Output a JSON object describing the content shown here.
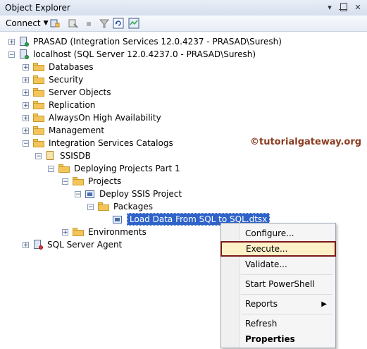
{
  "window": {
    "title": "Object Explorer",
    "controls": [
      "dropdown-icon",
      "pin-icon",
      "close-icon"
    ]
  },
  "toolbar": {
    "connect_label": "Connect",
    "icons": [
      "connect-object-icon",
      "disconnect-icon",
      "stop-icon",
      "filter-icon",
      "refresh-icon",
      "activity-monitor-icon"
    ]
  },
  "tree": {
    "items": [
      {
        "label": "PRASAD (Integration Services 12.0.4237 - PRASAD\\Suresh)",
        "icon": "server-icon",
        "expander": "+"
      },
      {
        "label": "localhost (SQL Server 12.0.4237.0 - PRASAD\\Suresh)",
        "icon": "server-icon",
        "expander": "−"
      },
      {
        "label": "Databases",
        "icon": "folder-icon",
        "expander": "+"
      },
      {
        "label": "Security",
        "icon": "folder-icon",
        "expander": "+"
      },
      {
        "label": "Server Objects",
        "icon": "folder-icon",
        "expander": "+"
      },
      {
        "label": "Replication",
        "icon": "folder-icon",
        "expander": "+"
      },
      {
        "label": "AlwaysOn High Availability",
        "icon": "folder-icon",
        "expander": "+"
      },
      {
        "label": "Management",
        "icon": "folder-icon",
        "expander": "+"
      },
      {
        "label": "Integration Services Catalogs",
        "icon": "folder-icon",
        "expander": "−"
      },
      {
        "label": "SSISDB",
        "icon": "catalog-icon",
        "expander": "−"
      },
      {
        "label": "Deploying Projects Part 1",
        "icon": "folder-icon",
        "expander": "−"
      },
      {
        "label": "Projects",
        "icon": "folder-icon",
        "expander": "−"
      },
      {
        "label": "Deploy SSIS Project",
        "icon": "project-icon",
        "expander": "−"
      },
      {
        "label": "Packages",
        "icon": "folder-icon",
        "expander": "−"
      },
      {
        "label": "Load Data From SQL to SQL.dtsx",
        "icon": "package-icon",
        "expander": ""
      },
      {
        "label": "Environments",
        "icon": "folder-icon",
        "expander": "+"
      },
      {
        "label": "SQL Server Agent",
        "icon": "agent-icon",
        "expander": "+"
      }
    ]
  },
  "watermark": "©tutorialgateway.org",
  "context_menu": {
    "items": [
      {
        "label": "Configure..."
      },
      {
        "label": "Execute...",
        "highlighted": true
      },
      {
        "label": "Validate..."
      },
      {
        "label": "Start PowerShell"
      },
      {
        "label": "Reports",
        "has_submenu": true
      },
      {
        "label": "Refresh"
      },
      {
        "label": "Properties",
        "bold": true
      }
    ]
  },
  "colors": {
    "selection": "#2f63c8",
    "highlight_border": "#7a1a1a",
    "highlight_fill": "#fff1c7",
    "watermark": "#8a3b1f"
  }
}
